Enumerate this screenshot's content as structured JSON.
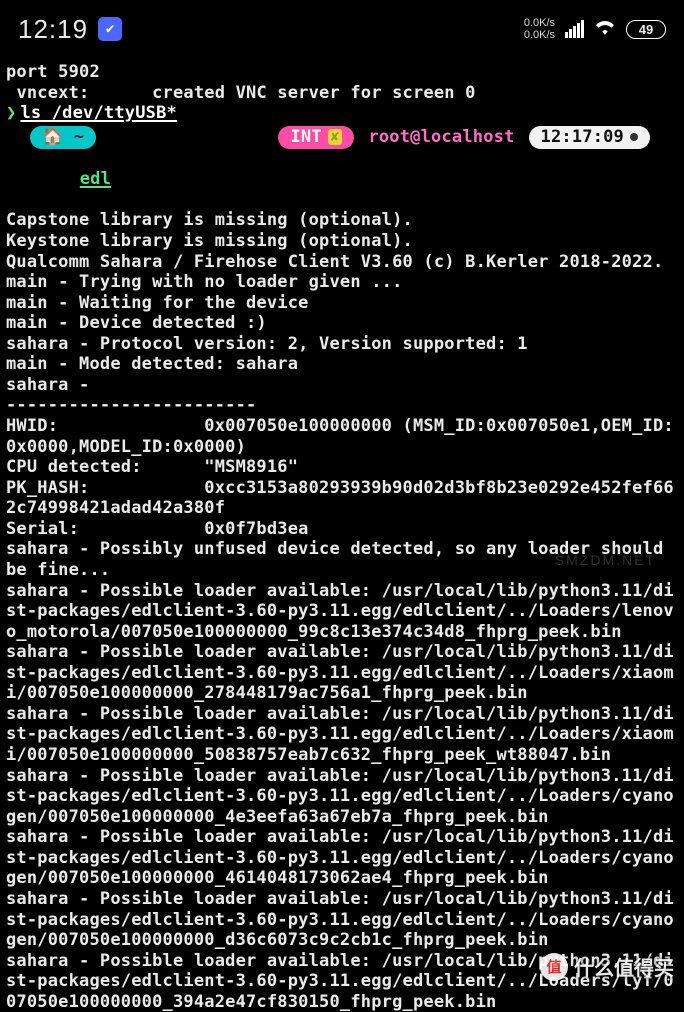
{
  "status_bar": {
    "time": "12:19",
    "net_up": "0.0K/s",
    "net_down": "0.0K/s",
    "battery": "49"
  },
  "terminal": {
    "pre_prompt_lines": [
      "port 5902",
      " vncext:      created VNC server for screen 0"
    ],
    "prompt_symbol": "❯",
    "command": "ls /dev/ttyUSB*",
    "ps_home": "🏠 ~",
    "ps_int": "INT",
    "ps_user_host": "root@localhost",
    "ps_time": "12:17:09",
    "edl_label": "edl",
    "output_lines": [
      "Capstone library is missing (optional).",
      "Keystone library is missing (optional).",
      "Qualcomm Sahara / Firehose Client V3.60 (c) B.Kerler 2018-2022.",
      "main - Trying with no loader given ...",
      "main - Waiting for the device",
      "main - Device detected :)",
      "sahara - Protocol version: 2, Version supported: 1",
      "main - Mode detected: sahara",
      "sahara - ",
      "------------------------",
      "HWID:              0x007050e100000000 (MSM_ID:0x007050e1,OEM_ID:0x0000,MODEL_ID:0x0000)",
      "CPU detected:      \"MSM8916\"",
      "PK_HASH:           0xcc3153a80293939b90d02d3bf8b23e0292e452fef662c74998421adad42a380f",
      "Serial:            0x0f7bd3ea",
      "",
      "sahara - Possibly unfused device detected, so any loader should be fine...",
      "sahara - Possible loader available: /usr/local/lib/python3.11/dist-packages/edlclient-3.60-py3.11.egg/edlclient/../Loaders/lenovo_motorola/007050e100000000_99c8c13e374c34d8_fhprg_peek.bin",
      "sahara - Possible loader available: /usr/local/lib/python3.11/dist-packages/edlclient-3.60-py3.11.egg/edlclient/../Loaders/xiaomi/007050e100000000_278448179ac756a1_fhprg_peek.bin",
      "sahara - Possible loader available: /usr/local/lib/python3.11/dist-packages/edlclient-3.60-py3.11.egg/edlclient/../Loaders/xiaomi/007050e100000000_50838757eab7c632_fhprg_peek_wt88047.bin",
      "sahara - Possible loader available: /usr/local/lib/python3.11/dist-packages/edlclient-3.60-py3.11.egg/edlclient/../Loaders/cyanogen/007050e100000000_4e3eefa63a67eb7a_fhprg_peek.bin",
      "sahara - Possible loader available: /usr/local/lib/python3.11/dist-packages/edlclient-3.60-py3.11.egg/edlclient/../Loaders/cyanogen/007050e100000000_4614048173062ae4_fhprg_peek.bin",
      "sahara - Possible loader available: /usr/local/lib/python3.11/dist-packages/edlclient-3.60-py3.11.egg/edlclient/../Loaders/cyanogen/007050e100000000_d36c6073c9c2cb1c_fhprg_peek.bin",
      "sahara - Possible loader available: /usr/local/lib/python3.11/dist-packages/edlclient-3.60-py3.11.egg/edlclient/../Loaders/lyf/007050e100000000_394a2e47cf830150_fhprg_peek.bin"
    ]
  },
  "watermark": {
    "badge": "值",
    "text": "什么值得买",
    "small": "SMZDM.NET"
  }
}
